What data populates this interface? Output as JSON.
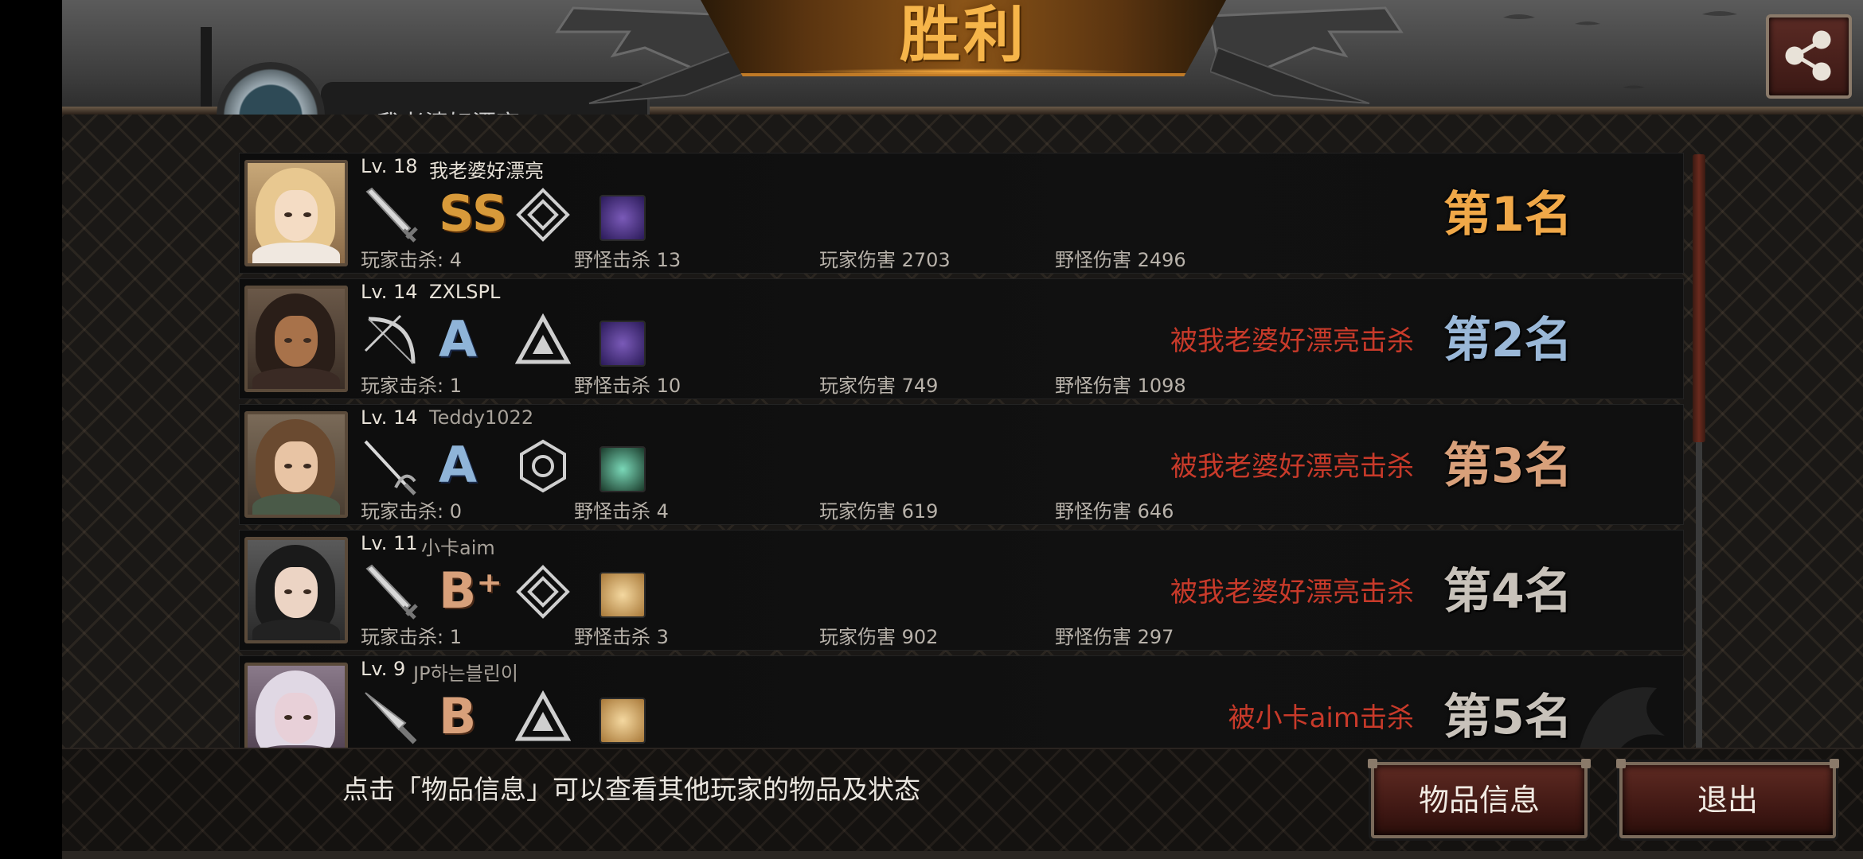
{
  "header": {
    "title": "胜利",
    "badge_name_partial": "我老婆好漂亮",
    "share_icon": "share-icon"
  },
  "players": [
    {
      "level": "Lv. 18",
      "name": "我老婆好漂亮",
      "name_color": "#e8e2d8",
      "weapon_icon": "sword-icon",
      "grade": "SS",
      "grade_color": "#d89a3a",
      "gear_icon": "diamond-rank-icon",
      "item_icon": "purple-beast-item",
      "player_kills": "玩家击杀: 4",
      "monster_kills": "野怪击杀 13",
      "player_damage": "玩家伤害 2703",
      "monster_damage": "野怪伤害 2496",
      "killed_by": "",
      "rank": "第1名",
      "rank_color": "#f0a848"
    },
    {
      "level": "Lv. 14",
      "name": "ZXLSPL",
      "name_color": "#e8e2d8",
      "weapon_icon": "bow-icon",
      "grade": "A",
      "grade_color": "#8fb4d8",
      "gear_icon": "triangle-rank-icon",
      "item_icon": "purple-beast-item",
      "player_kills": "玩家击杀: 1",
      "monster_kills": "野怪击杀 10",
      "player_damage": "玩家伤害 749",
      "monster_damage": "野怪伤害 1098",
      "killed_by": "被我老婆好漂亮击杀",
      "rank": "第2名",
      "rank_color": "#9ab8d8"
    },
    {
      "level": "Lv. 14",
      "name": "Teddy1022",
      "name_color": "#a8a29a",
      "weapon_icon": "rapier-icon",
      "grade": "A",
      "grade_color": "#8fb4d8",
      "gear_icon": "hexagon-rank-icon",
      "item_icon": "green-claw-item",
      "player_kills": "玩家击杀: 0",
      "monster_kills": "野怪击杀 4",
      "player_damage": "玩家伤害 619",
      "monster_damage": "野怪伤害 646",
      "killed_by": "被我老婆好漂亮击杀",
      "rank": "第3名",
      "rank_color": "#d8a07a"
    },
    {
      "level": "Lv. 11",
      "name": "小卡aim",
      "name_color": "#a8a29a",
      "weapon_icon": "sword-icon",
      "grade": "B⁺",
      "grade_color": "#d8a07a",
      "gear_icon": "diamond-rank-icon",
      "item_icon": "bread-item",
      "player_kills": "玩家击杀: 1",
      "monster_kills": "野怪击杀 3",
      "player_damage": "玩家伤害 902",
      "monster_damage": "野怪伤害 297",
      "killed_by": "被我老婆好漂亮击杀",
      "rank": "第4名",
      "rank_color": "#c8c2ba"
    },
    {
      "level": "Lv. 9",
      "name": "JP하는블린이",
      "name_color": "#a8a29a",
      "weapon_icon": "knife-icon",
      "grade": "B",
      "grade_color": "#d8a07a",
      "gear_icon": "triangle-rank-icon",
      "item_icon": "bread-item",
      "player_kills": "",
      "monster_kills": "",
      "player_damage": "",
      "monster_damage": "",
      "killed_by": "被小卡aim击杀",
      "rank": "第5名",
      "rank_color": "#c8c2ba"
    }
  ],
  "footer": {
    "hint": "点击「物品信息」可以查看其他玩家的物品及状态",
    "items_button": "物品信息",
    "exit_button": "退出"
  },
  "colors": {
    "title": "#f6b54a",
    "killed_by": "#c83a2a",
    "button_bg": "#5e2a22"
  }
}
